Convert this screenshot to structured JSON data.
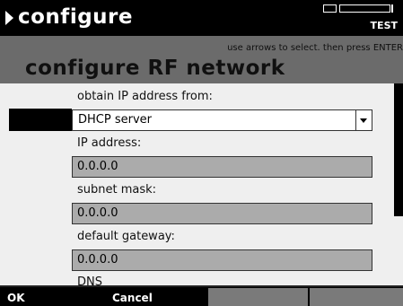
{
  "header": {
    "title": "configure",
    "mode": "TEST",
    "battery_icon": "battery-icon"
  },
  "subheader": {
    "hint": "use arrows to select. then press ENTER",
    "title": "configure RF network"
  },
  "form": {
    "obtain_ip": {
      "label": "obtain IP address from:",
      "value": "DHCP server"
    },
    "ip_address": {
      "label": "IP address:",
      "value": "0.0.0.0"
    },
    "subnet_mask": {
      "label": "subnet mask:",
      "value": "0.0.0.0"
    },
    "default_gateway": {
      "label": "default gateway:",
      "value": "0.0.0.0"
    },
    "next_label": "DNS"
  },
  "softkeys": {
    "ok": "OK",
    "cancel": "Cancel"
  },
  "colors": {
    "header_bg": "#000000",
    "subheader_bg": "#6b6b6b",
    "panel_bg": "#efefef",
    "field_bg": "#ababab",
    "softkey_inactive": "#7a7a7a"
  }
}
